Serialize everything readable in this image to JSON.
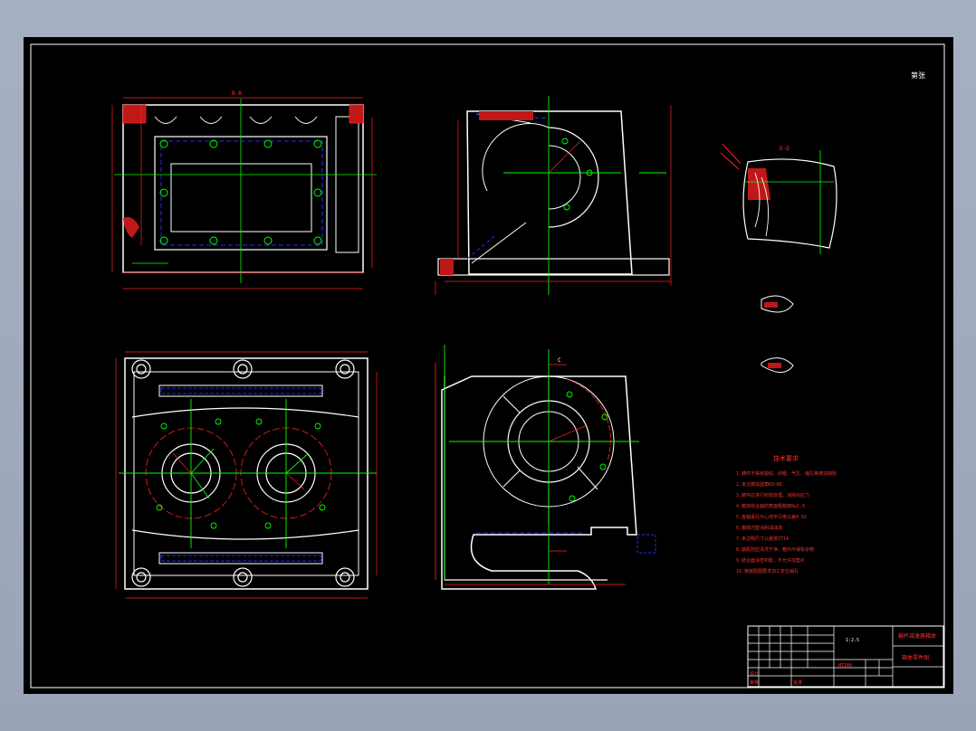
{
  "corner_mark": "第张",
  "section_labels": {
    "top_left_section": "B-B",
    "top_right_detail": "D-D",
    "bottom_right_cut": "C"
  },
  "notes": {
    "title": "技术要求",
    "lines": [
      "1.铸件不得有裂纹、砂眼、气孔、缩孔等铸造缺陷",
      "2.未注铸造圆角R3~R5",
      "3.铸件应进行时效处理，消除内应力",
      "4.箱体结合面的表面粗糙度Ra1.6",
      "5.各轴承孔中心线平行度公差0.02",
      "6.箱体内壁涂耐油油漆",
      "7.未注明尺寸公差按IT14",
      "8.装配前应清洗干净，箱内不得有杂物",
      "9.结合面涂密封胶，不允许加垫片",
      "10.按装配图要求加工定位销孔"
    ]
  },
  "title_block": {
    "scale": "1:2.5",
    "name": "蜗杆减速器箱体",
    "drawing_no": "箱体零件图",
    "designer": "设计",
    "checker": "审核",
    "approve": "批准",
    "material": "HT200"
  },
  "colors": {
    "outline": "#ffffff",
    "dimension": "#ff2020",
    "centerline": "#00ff00",
    "hidden": "#2030ff",
    "frame": "#ffffff",
    "text": "#ff3030"
  }
}
